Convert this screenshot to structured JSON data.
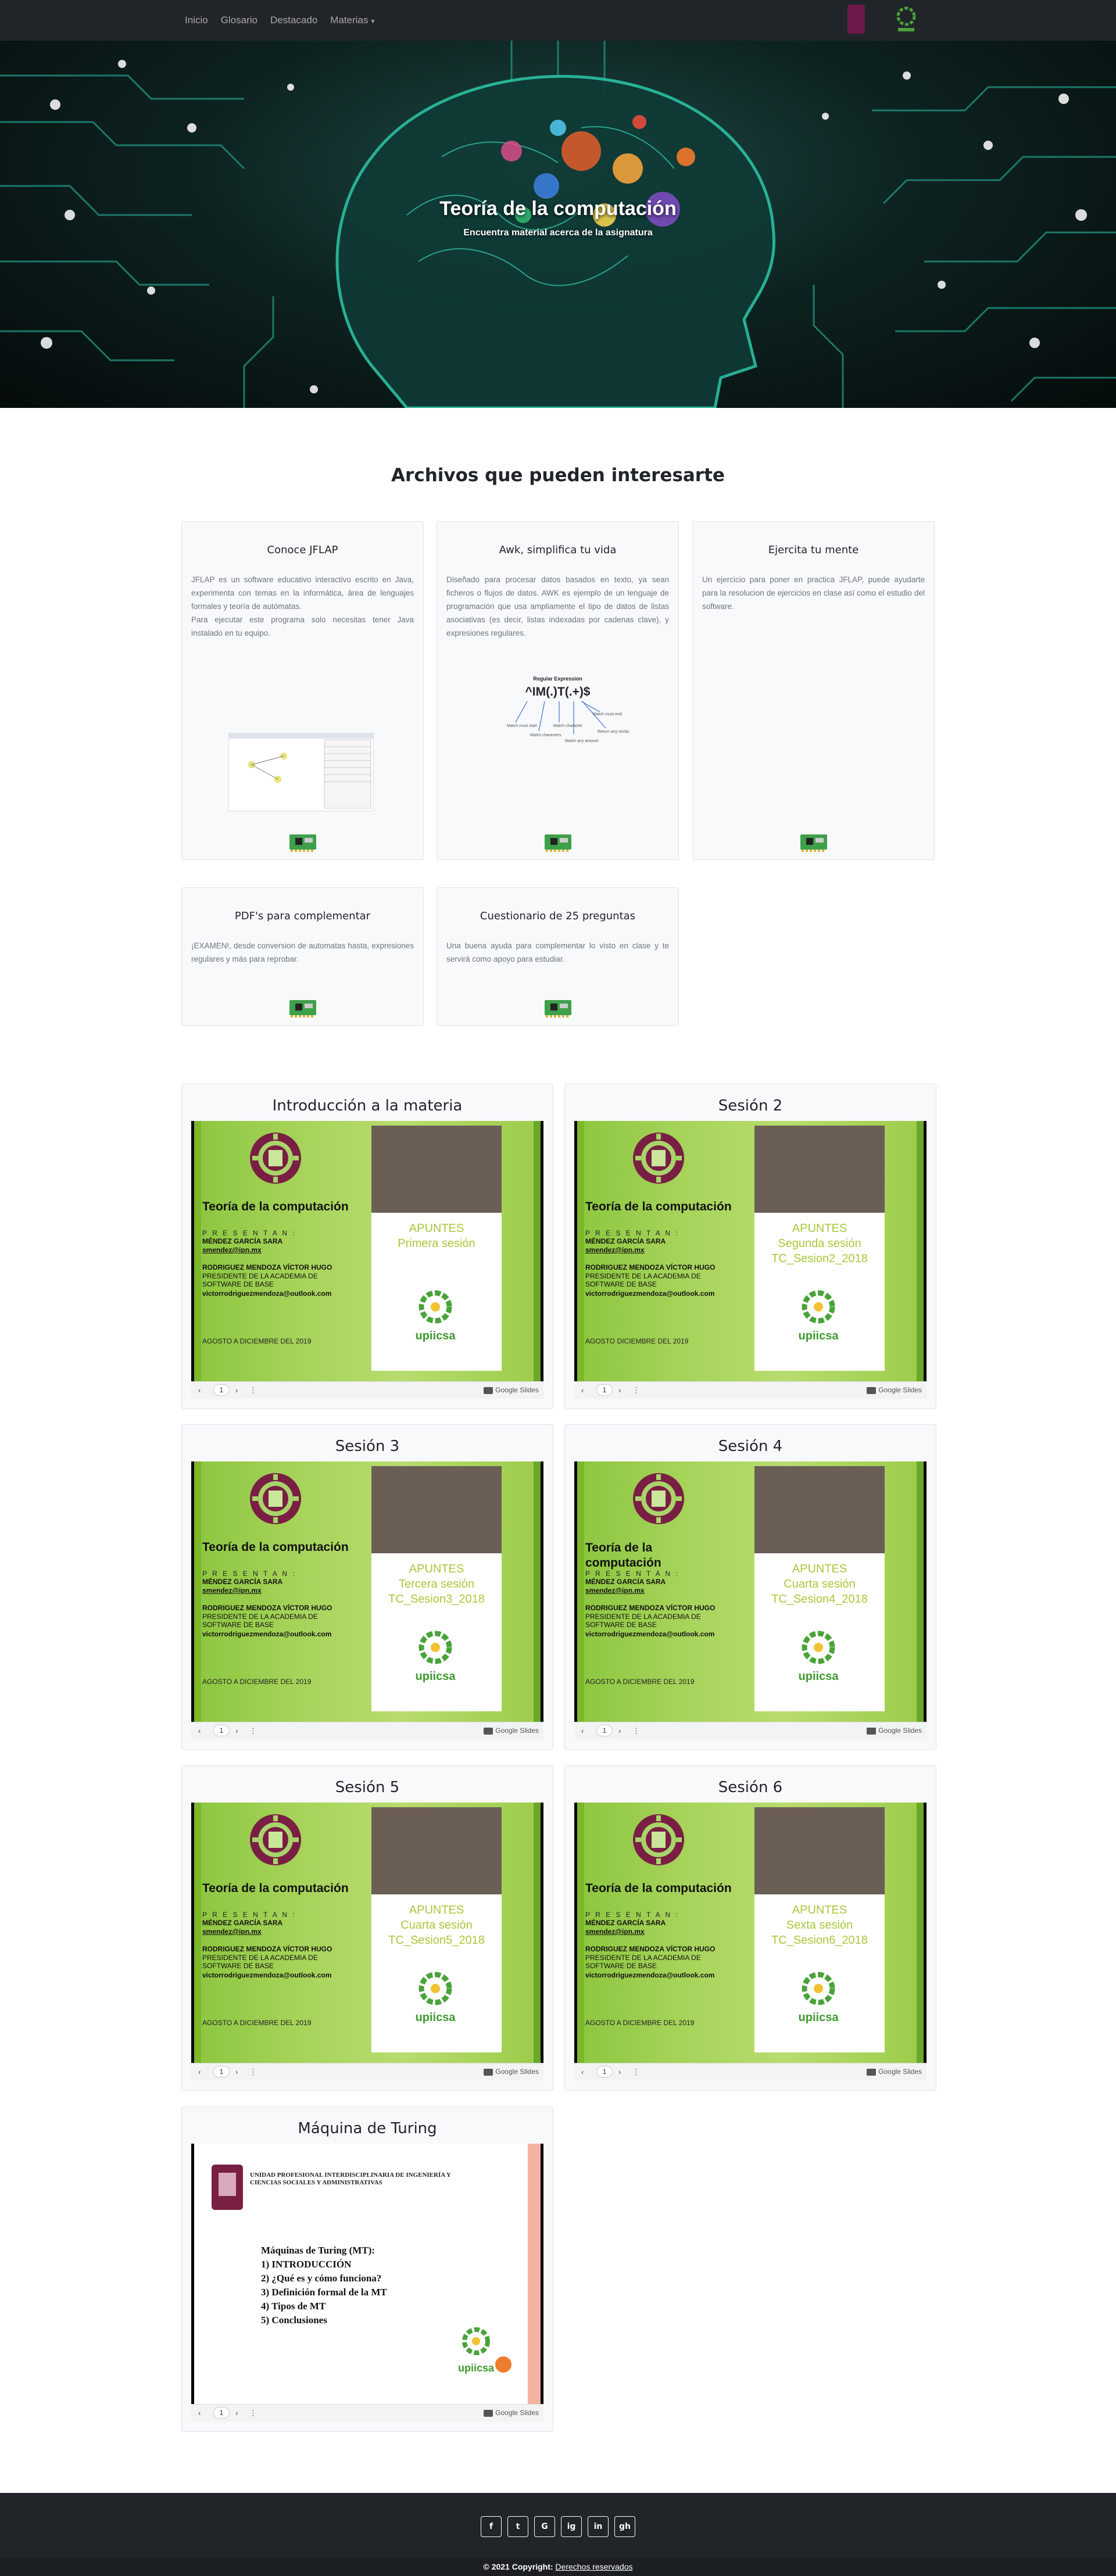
{
  "nav": {
    "links": [
      "Inicio",
      "Glosario",
      "Destacado",
      "Materias"
    ]
  },
  "hero": {
    "title": "Teoría de la computación",
    "subtitle": "Encuentra material acerca de la asignatura"
  },
  "section_title": "Archivos que pueden interesarte",
  "cards": [
    {
      "title": "Conoce JFLAP",
      "text": "JFLAP es un software educativo interactivo escrito en Java, experimenta con temas en la informática, área de lenguajes formales y teoría de autómatas.",
      "text2": "Para ejecutar este programa solo necesitas tener Java instalado en tu equipo."
    },
    {
      "title": "Awk, simplifica tu vida",
      "text": "Diseñado para procesar datos basados en texto, ya sean ficheros o flujos de datos. AWK es ejemplo de un lenguaje de programación que usa ampliamente el tipo de datos de listas asociativas (es decir, listas indexadas por cadenas clave), y expresiones regulares.",
      "regex": "^IM(.)T(.+)$",
      "regex_caption": "Regular Expression"
    },
    {
      "title": "Ejercita tu mente",
      "text": "Un ejercicio para poner en practica JFLAP, puede ayudarte para la resolucion de ejercicios en clase así como el estudio del software."
    },
    {
      "title": "PDF's para complementar",
      "text": "¡EXAMEN!, desde conversion de automatas hasta, expresiones regulares y más para reprobar."
    },
    {
      "title": "Cuestionario de 25 preguntas",
      "text": "Una buena ayuda para complementar lo visto en clase y te servirá como apoyo para estudiar."
    }
  ],
  "slide_common": {
    "subject": "Teoría de la computación",
    "presentan": "P R E S E N T A N :",
    "student": "MÉNDEZ GARCÍA SARA",
    "student_email": "smendez@ipn.mx",
    "professor": "RODRIGUEZ MENDOZA VÍCTOR HUGO",
    "professor_role": "PRESIDENTE DE LA ACADEMIA DE SOFTWARE DE BASE",
    "professor_email": "victorrodriguezmendoza@outlook.com",
    "upiicsa": "upiicsa",
    "page": "1",
    "gslides": "Google Slides"
  },
  "presentations": [
    {
      "title": "Introducción a la materia",
      "apuntes": "APUNTES",
      "line2": "Primera sesión",
      "line3": "",
      "date": "AGOSTO A DICIEMBRE DEL 2019"
    },
    {
      "title": "Sesión 2",
      "apuntes": "APUNTES",
      "line2": "Segunda sesión",
      "line3": "TC_Sesion2_2018",
      "date": "AGOSTO DICIEMBRE DEL 2019"
    },
    {
      "title": "Sesión 3",
      "apuntes": "APUNTES",
      "line2": "Tercera sesión",
      "line3": "TC_Sesion3_2018",
      "date": "AGOSTO A DICIEMBRE DEL 2019"
    },
    {
      "title": "Sesión 4",
      "apuntes": "APUNTES",
      "line2": "Cuarta sesión",
      "line3": "TC_Sesion4_2018",
      "date": "AGOSTO A DICIEMBRE DEL 2019"
    },
    {
      "title": "Sesión 5",
      "apuntes": "APUNTES",
      "line2": "Cuarta sesión",
      "line3": "TC_Sesion5_2018",
      "date": "AGOSTO A DICIEMBRE DEL 2019"
    },
    {
      "title": "Sesión 6",
      "apuntes": "APUNTES",
      "line2": "Sexta sesión",
      "line3": "TC_Sesion6_2018",
      "date": "AGOSTO A DICIEMBRE DEL 2019"
    }
  ],
  "turing": {
    "title": "Máquina de Turing",
    "institution": "UNIDAD PROFESIONAL INTERDISCIPLINARIA DE INGENIERÍA Y CIENCIAS SOCIALES Y ADMINISTRATIVAS",
    "heading": "Máquinas de Turing (MT):",
    "items": [
      "1)    INTRODUCCIÓN",
      "2)    ¿Qué es y cómo funciona?",
      "3)    Definición formal de la MT",
      "4)    Tipos de MT",
      "5)    Conclusiones"
    ]
  },
  "footer": {
    "social": [
      "f",
      "t",
      "G",
      "ig",
      "in",
      "gh"
    ],
    "copyright_prefix": "© 2021 Copyright: ",
    "copyright_link": "Derechos reservados"
  },
  "colors": {
    "navbar": "#212529",
    "slide_green": "#8cc63f",
    "apuntes_text": "#a8c83a",
    "ipn_maroon": "#6d1a4a"
  }
}
